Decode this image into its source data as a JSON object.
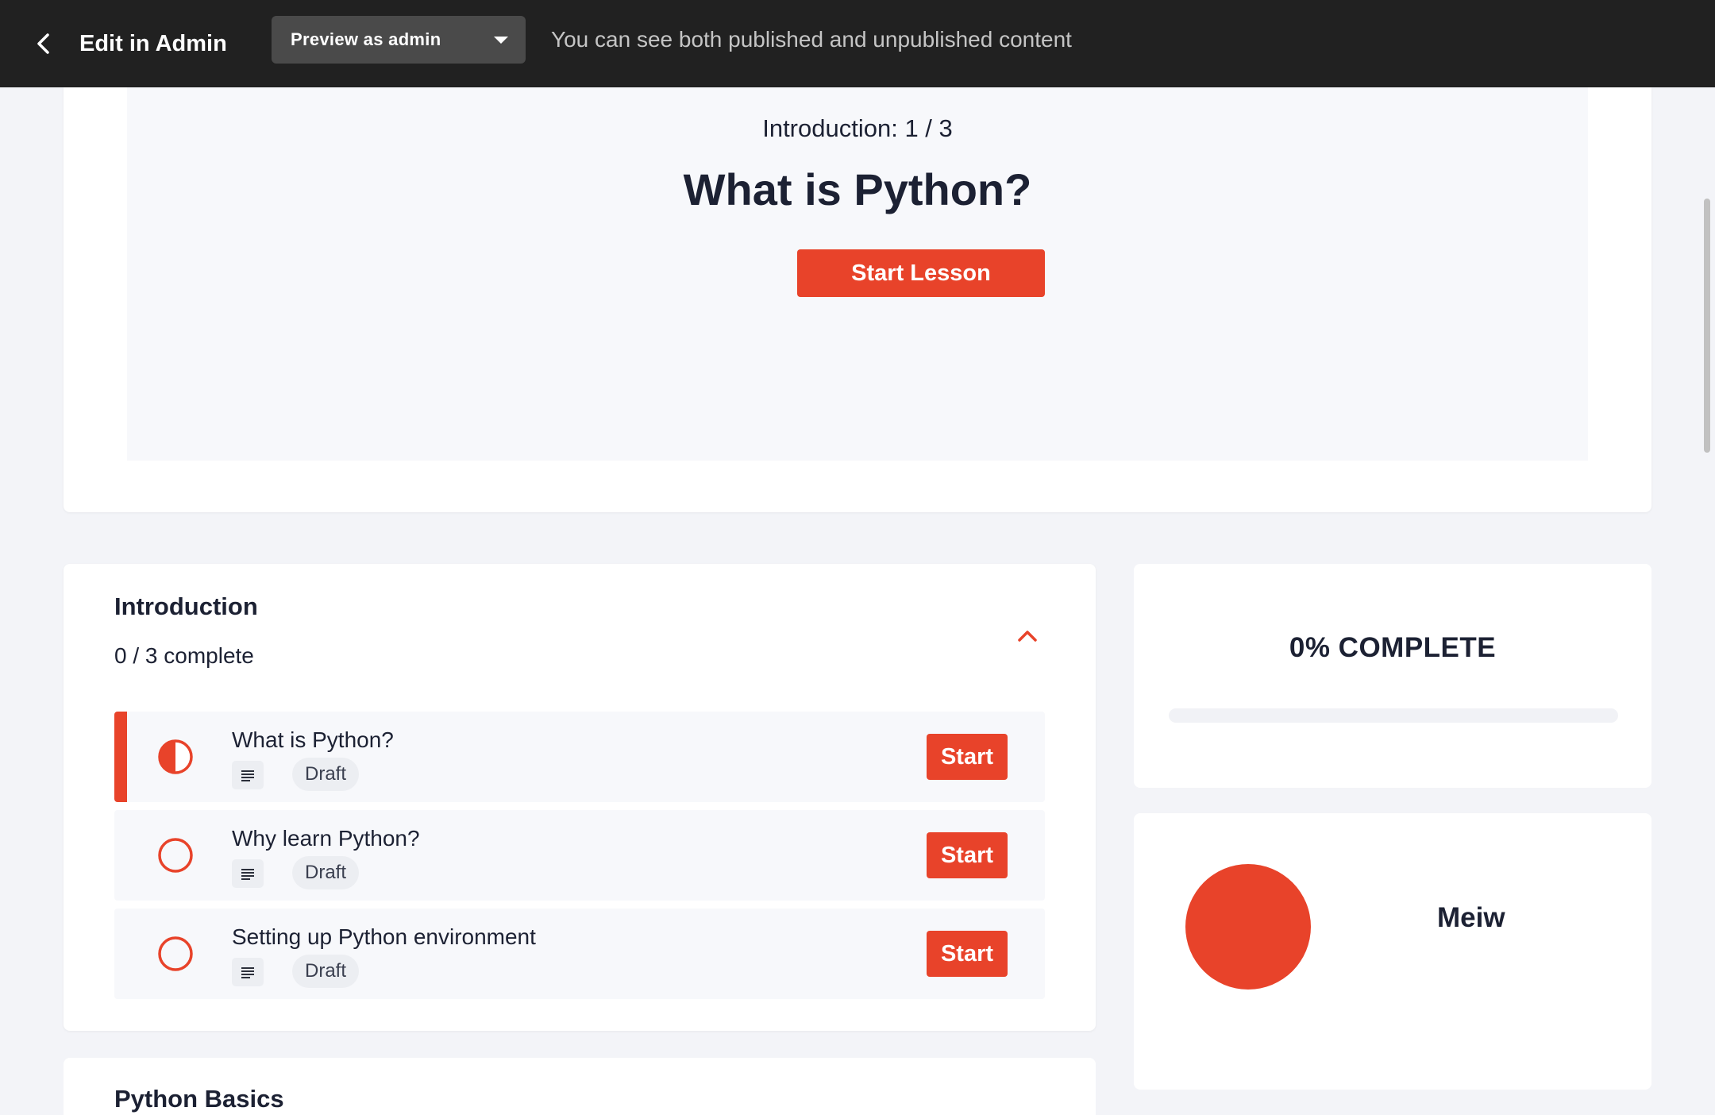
{
  "admin_bar": {
    "back_label": "Edit in Admin",
    "preview_select": "Preview as admin",
    "note": "You can see both published and unpublished content"
  },
  "hero": {
    "section_progress": "Introduction: 1 / 3",
    "title": "What is Python?",
    "button_label": "Start Lesson"
  },
  "section": {
    "title": "Introduction",
    "progress": "0 / 3 complete",
    "lessons": [
      {
        "title": "What is Python?",
        "badge": "Draft",
        "button": "Start",
        "status": "in-progress"
      },
      {
        "title": "Why learn Python?",
        "badge": "Draft",
        "button": "Start",
        "status": "not-started"
      },
      {
        "title": "Setting up Python environment",
        "badge": "Draft",
        "button": "Start",
        "status": "not-started"
      }
    ]
  },
  "next_section": {
    "title": "Python Basics"
  },
  "progress_card": {
    "label": "0% COMPLETE",
    "percent": 0
  },
  "profile": {
    "name": "Meiw"
  },
  "colors": {
    "accent": "#e8432a",
    "topbar": "#212121",
    "text": "#1c2133"
  }
}
